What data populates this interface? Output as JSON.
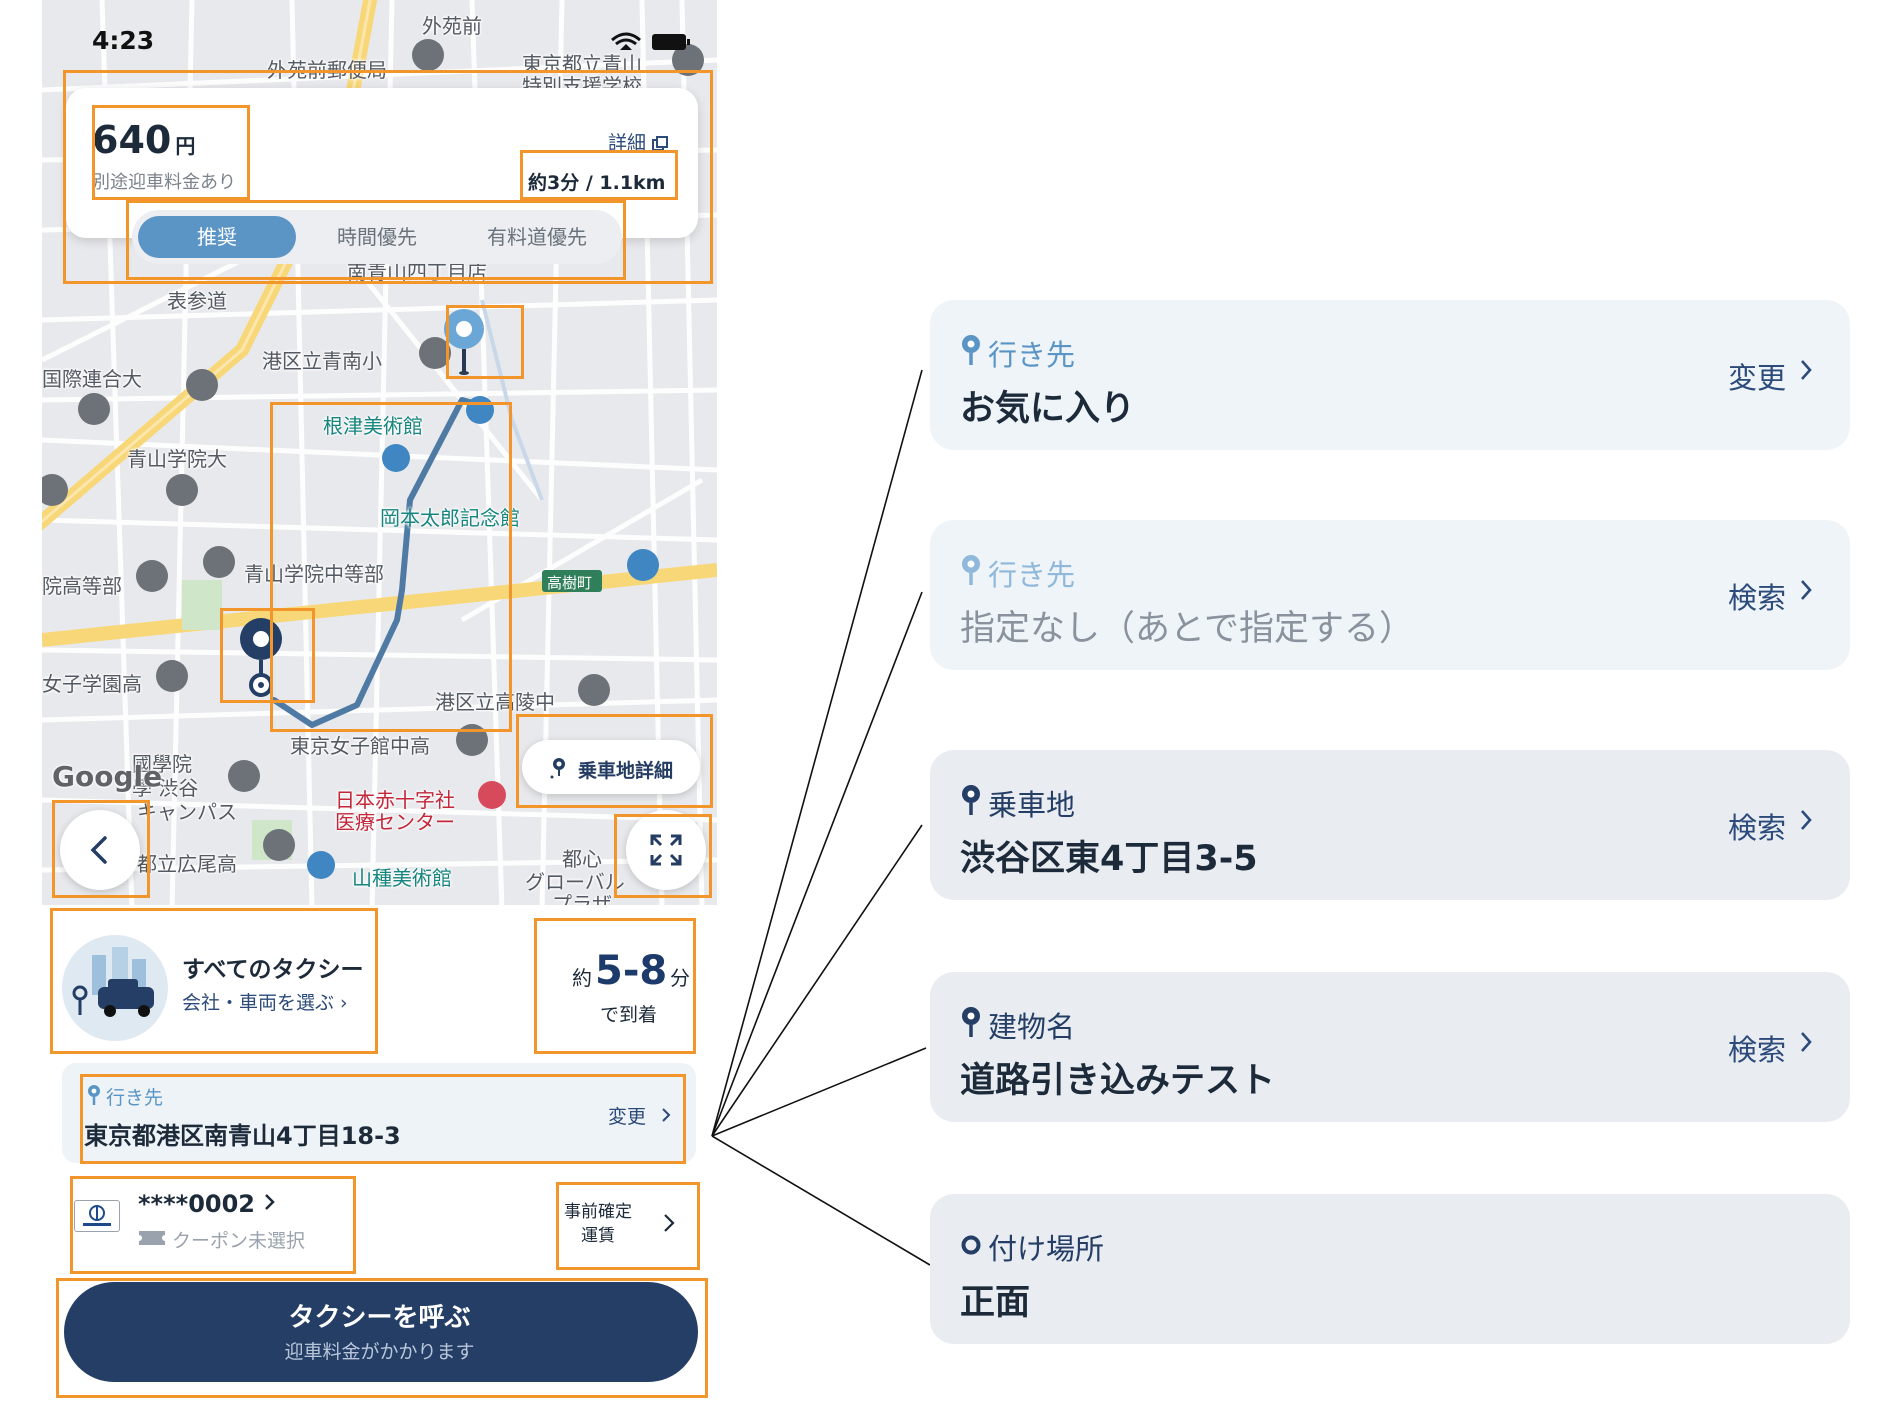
{
  "status_bar": {
    "time": "4:23"
  },
  "map": {
    "labels": {
      "gaien_mae": "外苑前",
      "gaien_post": "外苑前郵便局",
      "tokyo_school": "東京都立青山",
      "tokyo_school2": "特別支援学校",
      "minami_aoyama": "南青山四丁目店",
      "omotesando": "表参道",
      "aoyama_elem": "港区立青南小",
      "kokusai": "国際連合大",
      "nezu": "根津美術館",
      "aoyama_gakuin": "青山学院大",
      "okamoto": "岡本太郎記念館",
      "aoyama_chu": "青山学院中等部",
      "koutou": "院高等部",
      "takagi": "高樹町",
      "joshi": "女子学園高",
      "koryo": "港区立高陵中",
      "tokyo_joshikan": "東京女子館中高",
      "kokugakuin": "國學院",
      "kokugakuin2": "學 渋谷",
      "kokugakuin3": "キャンパス",
      "red_cross": "日本赤十字社",
      "red_cross2": "医療センター",
      "hiroo": "都立広尾高",
      "yamatane": "山種美術館",
      "toshin": "都心",
      "global": "グローバル",
      "plaza": "プラザ",
      "google": "Google"
    },
    "fare_card": {
      "amount": "640",
      "currency": "円",
      "note": "別途迎車料金あり",
      "detail": "詳細",
      "eta_distance": "約3分 / 1.1km",
      "route_options": [
        {
          "label": "推奨",
          "active": true
        },
        {
          "label": "時間優先",
          "active": false
        },
        {
          "label": "有料道優先",
          "active": false
        }
      ]
    },
    "pickup_detail_label": "乗車地詳細"
  },
  "taxi": {
    "title": "すべてのタクシー",
    "subtitle": "会社・車両を選ぶ ›",
    "eta_prefix": "約",
    "eta_value": "5-8",
    "eta_unit": "分",
    "eta_suffix": "で到着"
  },
  "destination": {
    "label": "行き先",
    "address": "東京都港区南青山4丁目18-3",
    "action": "変更"
  },
  "payment": {
    "card": "****0002",
    "coupon": "クーポン未選択",
    "prefare_line1": "事前確定",
    "prefare_line2": "運賃"
  },
  "call_button": {
    "title": "タクシーを呼ぶ",
    "subtitle": "迎車料金がかかります"
  },
  "panels": [
    {
      "label": "行き先",
      "value": "お気に入り",
      "action": "変更",
      "style": "destination"
    },
    {
      "label": "行き先",
      "value": "指定なし（あとで指定する）",
      "action": "検索",
      "style": "destination-empty"
    },
    {
      "label": "乗車地",
      "value": "渋谷区東4丁目3-5",
      "action": "検索",
      "style": "pickup"
    },
    {
      "label": "建物名",
      "value": "道路引き込みテスト",
      "action": "検索",
      "style": "pickup"
    },
    {
      "label": "付け場所",
      "value": "正面",
      "action": "",
      "style": "pickup-dot"
    }
  ],
  "colors": {
    "accent": "#5b95c6",
    "navy": "#253e66",
    "highlight": "#f2962b",
    "map_bg": "#e8e9ec"
  }
}
